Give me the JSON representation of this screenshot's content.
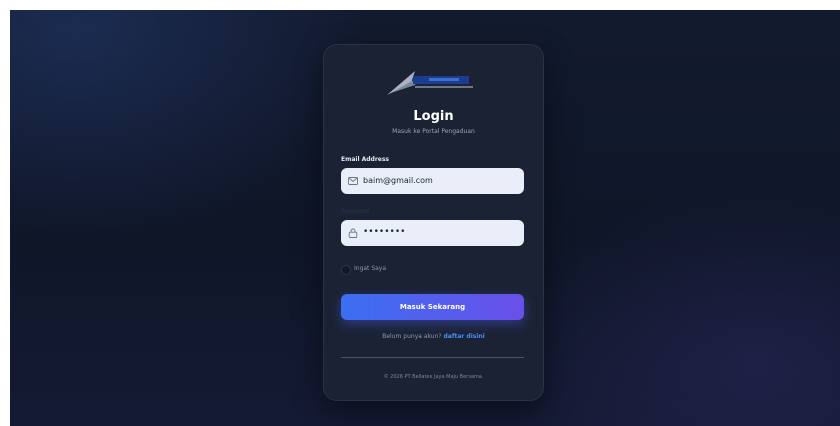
{
  "login": {
    "title": "Login",
    "subtitle": "Masuk ke Portal Pengaduan",
    "email_label": "Email Address",
    "email_value": "baim@gmail.com",
    "password_label": "Password",
    "password_value": "••••••••",
    "remember_label": "Ingat Saya",
    "remember_checked": false,
    "submit_label": "Masuk Sekarang",
    "register_prompt": "Belum punya akun?",
    "register_link": "daftar disini",
    "footer": "© 2026 PT Bellatex Jaya Maju Bersama."
  },
  "icons": {
    "email": "mail-icon",
    "password": "lock-icon"
  },
  "colors": {
    "background": "#111a2e",
    "card": "#1b2234",
    "input": "#e9eef9",
    "button_start": "#3b6ff2",
    "button_end": "#6a4fe8",
    "link": "#4f8ef7"
  }
}
